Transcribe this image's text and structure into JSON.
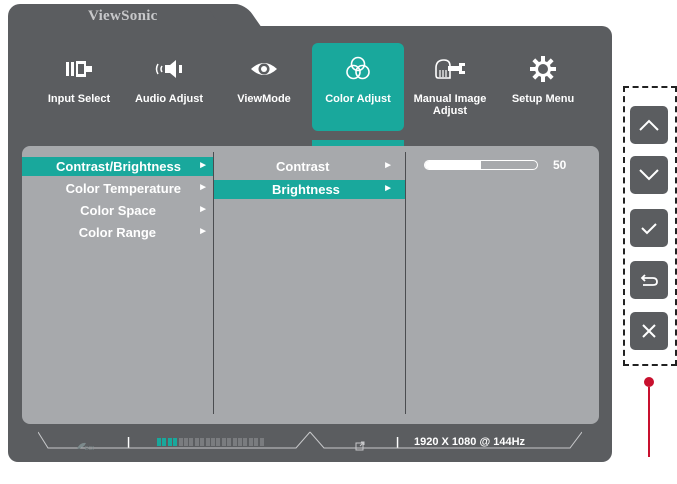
{
  "brand": "ViewSonic",
  "menu": [
    {
      "label": "Input Select",
      "icon": "input-select-icon",
      "active": false
    },
    {
      "label": "Audio Adjust",
      "icon": "speaker-icon",
      "active": false
    },
    {
      "label": "ViewMode",
      "icon": "eye-icon",
      "active": false
    },
    {
      "label": "Color Adjust",
      "icon": "color-circles-icon",
      "active": true
    },
    {
      "label": "Manual Image Adjust",
      "icon": "hand-wrench-icon",
      "active": false
    },
    {
      "label": "Setup Menu",
      "icon": "gear-icon",
      "active": false
    }
  ],
  "submenu": [
    {
      "label": "Contrast/Brightness",
      "selected": true
    },
    {
      "label": "Color Temperature",
      "selected": false
    },
    {
      "label": "Color Space",
      "selected": false
    },
    {
      "label": "Color Range",
      "selected": false
    }
  ],
  "options": [
    {
      "label": "Contrast",
      "selected": false
    },
    {
      "label": "Brightness",
      "selected": true
    }
  ],
  "slider": {
    "value": "50",
    "fill_fraction": 0.5
  },
  "status": {
    "signal_level_fraction": 0.2,
    "resolution": "1920 X 1080 @ 144Hz"
  },
  "keys": [
    {
      "name": "up-key",
      "icon": "chevron-up-icon"
    },
    {
      "name": "down-key",
      "icon": "chevron-down-icon"
    },
    {
      "name": "confirm-key",
      "icon": "check-icon"
    },
    {
      "name": "return-key",
      "icon": "return-icon"
    },
    {
      "name": "exit-key",
      "icon": "close-icon"
    }
  ],
  "colors": {
    "accent": "#19a89c",
    "osd_bg": "#5b5d60",
    "panel_bg": "#a7a9ac",
    "led": "#c8102e"
  }
}
